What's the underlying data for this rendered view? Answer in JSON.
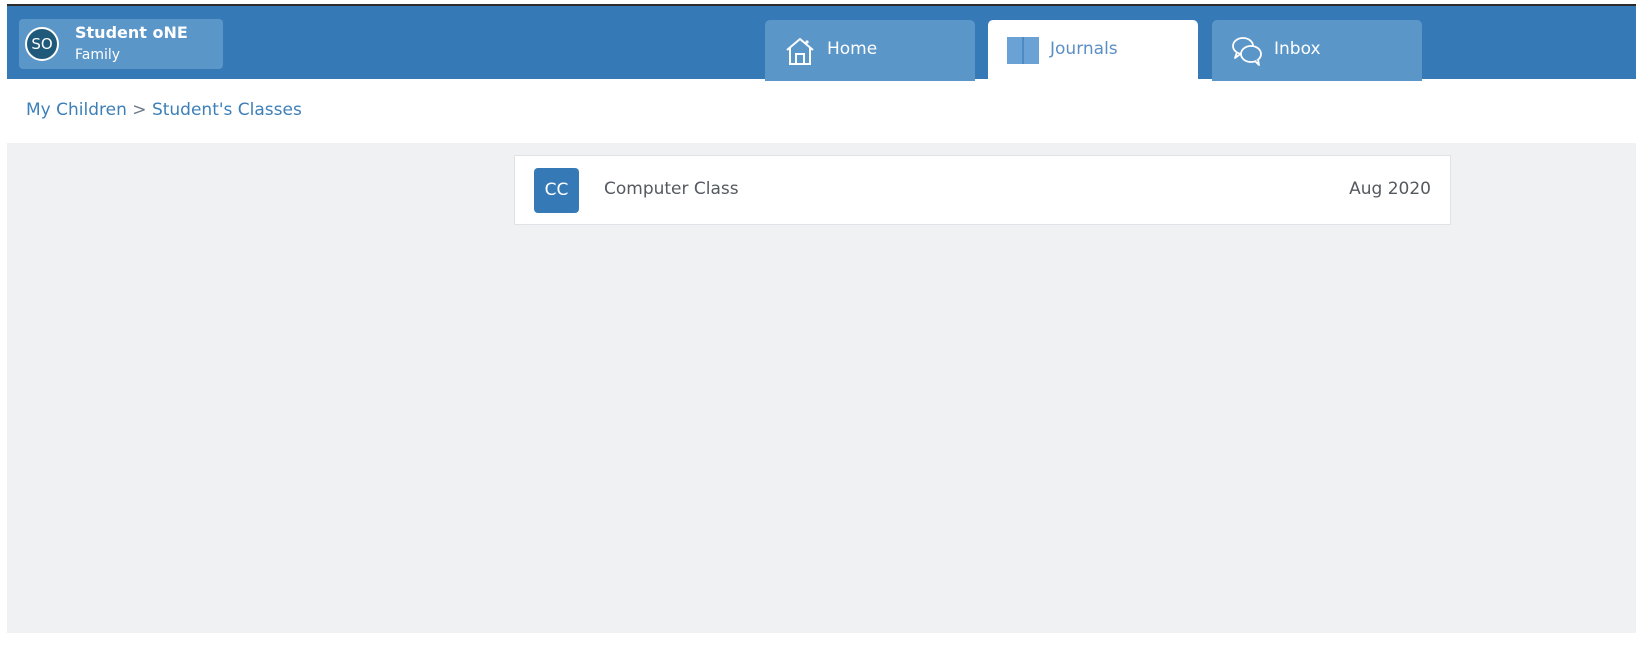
{
  "header": {
    "user": {
      "initials": "SO",
      "name": "Student oNE",
      "role": "Family"
    },
    "tabs": [
      {
        "label": "Home",
        "icon": "home-icon",
        "active": false
      },
      {
        "label": "Journals",
        "icon": "book-icon",
        "active": true
      },
      {
        "label": "Inbox",
        "icon": "chat-bubbles-icon",
        "active": false
      }
    ]
  },
  "breadcrumb": {
    "items": [
      "My Children",
      "Student's Classes"
    ],
    "separator": ">"
  },
  "classes": [
    {
      "initials": "CC",
      "name": "Computer Class",
      "date": "Aug 2020"
    }
  ],
  "colors": {
    "header": "#357ab7",
    "tab": "#5b96c9",
    "active_tab_text": "#5b8fc4",
    "content_background": "#f0f1f3"
  }
}
